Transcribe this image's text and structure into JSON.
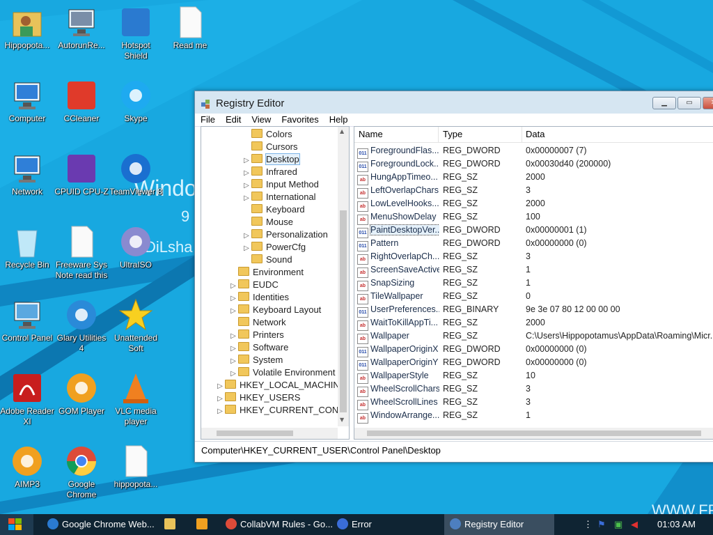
{
  "desktop": {
    "watermark": {
      "line1": "Windo",
      "line2": "9",
      "line3": "DiLsha"
    },
    "bottom_right_text": "WWW.FR",
    "icons": [
      {
        "label": "Hippopota...",
        "icon": "user-folder-icon"
      },
      {
        "label": "AutorunRe...",
        "icon": "autorun-computer-icon"
      },
      {
        "label": "Hotspot\nShield",
        "icon": "hotspot-shield-icon"
      },
      {
        "label": "Read me",
        "icon": "text-file-icon"
      },
      {
        "label": "Computer",
        "icon": "computer-icon"
      },
      {
        "label": "CCleaner",
        "icon": "ccleaner-icon"
      },
      {
        "label": "Skype",
        "icon": "skype-icon"
      },
      {
        "label": "Network",
        "icon": "network-icon"
      },
      {
        "label": "CPUID CPU-Z",
        "icon": "cpuz-icon"
      },
      {
        "label": "TeamViewer 8",
        "icon": "teamviewer-icon"
      },
      {
        "label": "Recycle Bin",
        "icon": "recycle-bin-icon"
      },
      {
        "label": "Freeware Sys\nNote read this",
        "icon": "text-file-icon"
      },
      {
        "label": "UltraISO",
        "icon": "ultraiso-icon"
      },
      {
        "label": "Control Panel",
        "icon": "control-panel-icon"
      },
      {
        "label": "Glary Utilities\n4",
        "icon": "glary-utilities-icon"
      },
      {
        "label": "Unattended\nSoft",
        "icon": "star-icon"
      },
      {
        "label": "Adobe Reader\nXI",
        "icon": "adobe-reader-icon"
      },
      {
        "label": "GOM Player",
        "icon": "gom-player-icon"
      },
      {
        "label": "VLC media\nplayer",
        "icon": "vlc-icon"
      },
      {
        "label": "AIMP3",
        "icon": "aimp-icon"
      },
      {
        "label": "Google\nChrome",
        "icon": "chrome-icon"
      },
      {
        "label": "hippopota...",
        "icon": "text-file-icon"
      }
    ]
  },
  "window": {
    "title": "Registry Editor",
    "menu": [
      "File",
      "Edit",
      "View",
      "Favorites",
      "Help"
    ],
    "tree": [
      {
        "label": "Colors",
        "expander": false
      },
      {
        "label": "Cursors",
        "expander": false
      },
      {
        "label": "Desktop",
        "expander": true,
        "selected": true
      },
      {
        "label": "Infrared",
        "expander": true
      },
      {
        "label": "Input Method",
        "expander": true
      },
      {
        "label": "International",
        "expander": true
      },
      {
        "label": "Keyboard",
        "expander": false
      },
      {
        "label": "Mouse",
        "expander": false
      },
      {
        "label": "Personalization",
        "expander": true
      },
      {
        "label": "PowerCfg",
        "expander": true
      },
      {
        "label": "Sound",
        "expander": false
      },
      {
        "label": "Environment",
        "expander": false
      },
      {
        "label": "EUDC",
        "expander": true
      },
      {
        "label": "Identities",
        "expander": true
      },
      {
        "label": "Keyboard Layout",
        "expander": true
      },
      {
        "label": "Network",
        "expander": false
      },
      {
        "label": "Printers",
        "expander": true
      },
      {
        "label": "Software",
        "expander": true
      },
      {
        "label": "System",
        "expander": true
      },
      {
        "label": "Volatile Environment",
        "expander": true
      },
      {
        "label": "HKEY_LOCAL_MACHINE",
        "expander": true
      },
      {
        "label": "HKEY_USERS",
        "expander": true
      },
      {
        "label": "HKEY_CURRENT_CONFIG",
        "expander": true
      }
    ],
    "columns": [
      "Name",
      "Type",
      "Data"
    ],
    "values": [
      {
        "name": "ForegroundFlas...",
        "type": "REG_DWORD",
        "data": "0x00000007 (7)"
      },
      {
        "name": "ForegroundLock...",
        "type": "REG_DWORD",
        "data": "0x00030d40 (200000)"
      },
      {
        "name": "HungAppTimeo...",
        "type": "REG_SZ",
        "data": "2000"
      },
      {
        "name": "LeftOverlapChars",
        "type": "REG_SZ",
        "data": "3"
      },
      {
        "name": "LowLevelHooks...",
        "type": "REG_SZ",
        "data": "2000"
      },
      {
        "name": "MenuShowDelay",
        "type": "REG_SZ",
        "data": "100"
      },
      {
        "name": "PaintDesktopVer...",
        "type": "REG_DWORD",
        "data": "0x00000001 (1)",
        "selected": true
      },
      {
        "name": "Pattern",
        "type": "REG_DWORD",
        "data": "0x00000000 (0)"
      },
      {
        "name": "RightOverlapCh...",
        "type": "REG_SZ",
        "data": "3"
      },
      {
        "name": "ScreenSaveActive",
        "type": "REG_SZ",
        "data": "1"
      },
      {
        "name": "SnapSizing",
        "type": "REG_SZ",
        "data": "1"
      },
      {
        "name": "TileWallpaper",
        "type": "REG_SZ",
        "data": "0"
      },
      {
        "name": "UserPreferences...",
        "type": "REG_BINARY",
        "data": "9e 3e 07 80 12 00 00 00"
      },
      {
        "name": "WaitToKillAppTi...",
        "type": "REG_SZ",
        "data": "2000"
      },
      {
        "name": "Wallpaper",
        "type": "REG_SZ",
        "data": "C:\\Users\\Hippopotamus\\AppData\\Roaming\\Micr..."
      },
      {
        "name": "WallpaperOriginX",
        "type": "REG_DWORD",
        "data": "0x00000000 (0)"
      },
      {
        "name": "WallpaperOriginY",
        "type": "REG_DWORD",
        "data": "0x00000000 (0)"
      },
      {
        "name": "WallpaperStyle",
        "type": "REG_SZ",
        "data": "10"
      },
      {
        "name": "WheelScrollChars",
        "type": "REG_SZ",
        "data": "3"
      },
      {
        "name": "WheelScrollLines",
        "type": "REG_SZ",
        "data": "3"
      },
      {
        "name": "WindowArrange...",
        "type": "REG_SZ",
        "data": "1"
      }
    ],
    "status_path": "Computer\\HKEY_CURRENT_USER\\Control Panel\\Desktop"
  },
  "taskbar": {
    "items": [
      {
        "label": "Google Chrome Web...",
        "icon": "ie-icon",
        "active": false
      },
      {
        "label": "",
        "icon": "folder-icon",
        "active": false
      },
      {
        "label": "",
        "icon": "media-player-icon",
        "active": false
      },
      {
        "label": "CollabVM Rules - Go...",
        "icon": "chrome-icon",
        "active": false
      },
      {
        "label": "Error",
        "icon": "info-icon",
        "active": false
      },
      {
        "label": "Registry Editor",
        "icon": "registry-icon",
        "active": true
      }
    ],
    "clock": "01:03 AM"
  },
  "colors": {
    "desktop": "#18a8e0",
    "taskbar": "#0f2433",
    "selection": "#e5f1fb"
  }
}
